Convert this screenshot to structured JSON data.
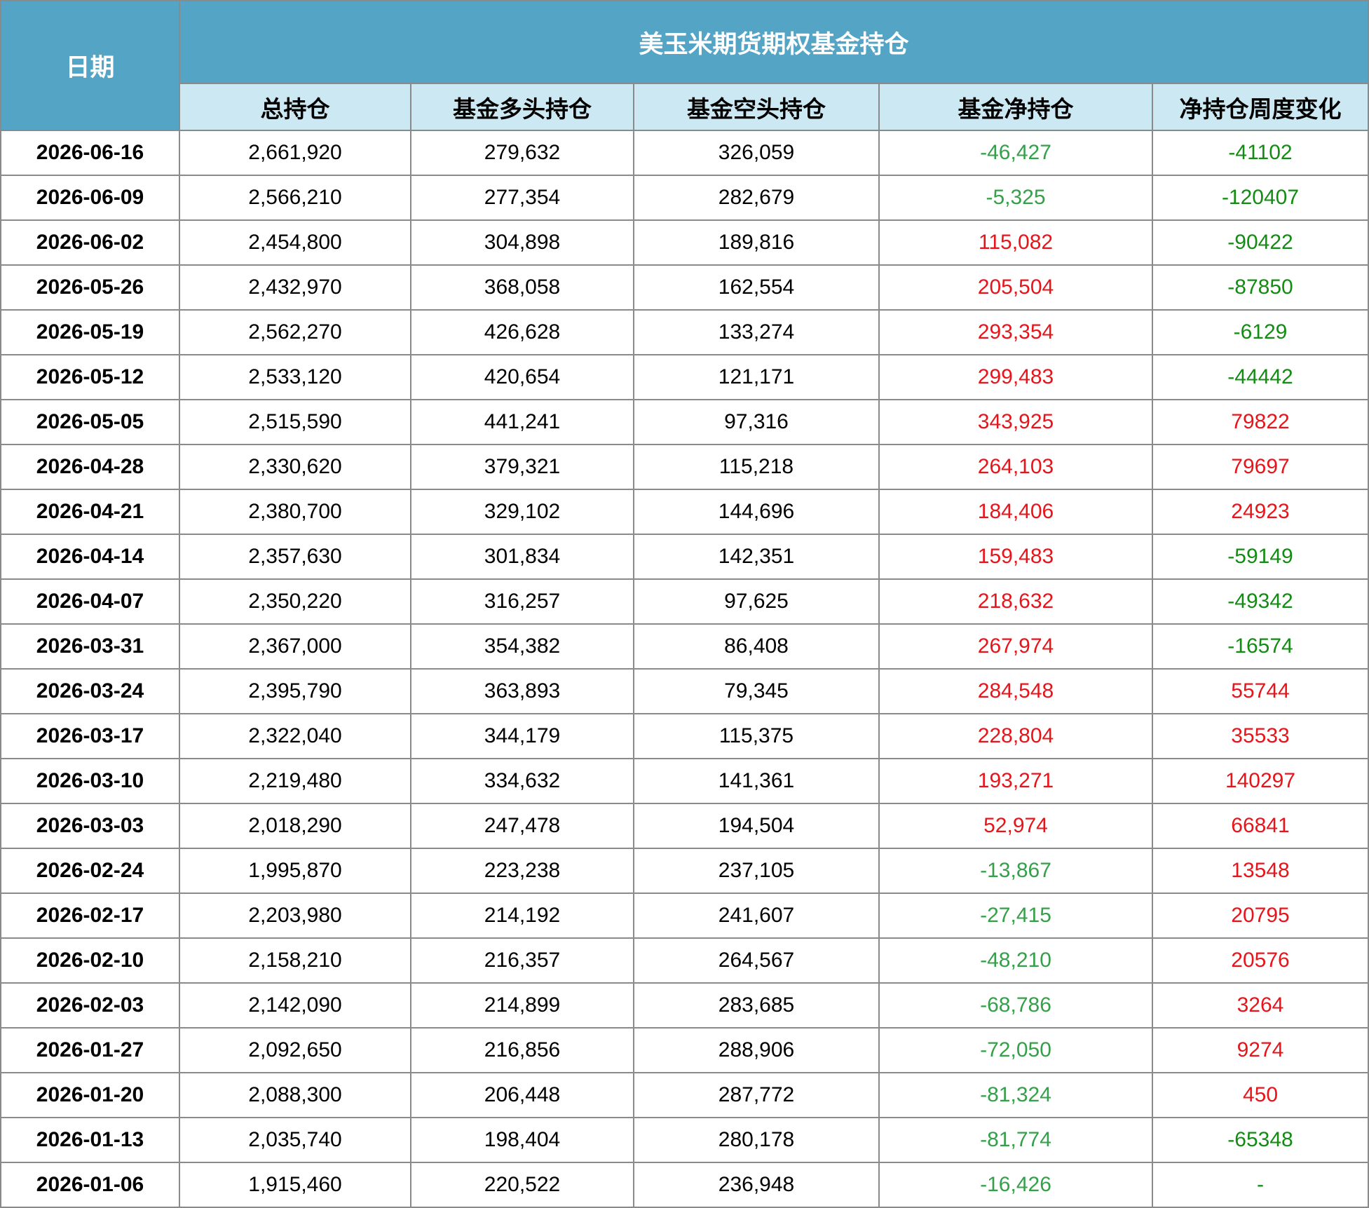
{
  "colors": {
    "header_dark": "#54a4c6",
    "header_light": "#cce8f2",
    "grid": "#8a8a8a",
    "positive": "#e8141a",
    "net_negative": "#35a04a",
    "change_negative": "#128c12"
  },
  "chart_data": {
    "type": "table",
    "title": "美玉米期货期权基金持仓",
    "row_header": "日期",
    "columns": [
      "总持仓",
      "基金多头持仓",
      "基金空头持仓",
      "基金净持仓",
      "净持仓周度变化"
    ],
    "rows": [
      [
        "2026-06-16",
        "2,661,920",
        "279,632",
        "326,059",
        "-46,427",
        "-41102"
      ],
      [
        "2026-06-09",
        "2,566,210",
        "277,354",
        "282,679",
        "-5,325",
        "-120407"
      ],
      [
        "2026-06-02",
        "2,454,800",
        "304,898",
        "189,816",
        "115,082",
        "-90422"
      ],
      [
        "2026-05-26",
        "2,432,970",
        "368,058",
        "162,554",
        "205,504",
        "-87850"
      ],
      [
        "2026-05-19",
        "2,562,270",
        "426,628",
        "133,274",
        "293,354",
        "-6129"
      ],
      [
        "2026-05-12",
        "2,533,120",
        "420,654",
        "121,171",
        "299,483",
        "-44442"
      ],
      [
        "2026-05-05",
        "2,515,590",
        "441,241",
        "97,316",
        "343,925",
        "79822"
      ],
      [
        "2026-04-28",
        "2,330,620",
        "379,321",
        "115,218",
        "264,103",
        "79697"
      ],
      [
        "2026-04-21",
        "2,380,700",
        "329,102",
        "144,696",
        "184,406",
        "24923"
      ],
      [
        "2026-04-14",
        "2,357,630",
        "301,834",
        "142,351",
        "159,483",
        "-59149"
      ],
      [
        "2026-04-07",
        "2,350,220",
        "316,257",
        "97,625",
        "218,632",
        "-49342"
      ],
      [
        "2026-03-31",
        "2,367,000",
        "354,382",
        "86,408",
        "267,974",
        "-16574"
      ],
      [
        "2026-03-24",
        "2,395,790",
        "363,893",
        "79,345",
        "284,548",
        "55744"
      ],
      [
        "2026-03-17",
        "2,322,040",
        "344,179",
        "115,375",
        "228,804",
        "35533"
      ],
      [
        "2026-03-10",
        "2,219,480",
        "334,632",
        "141,361",
        "193,271",
        "140297"
      ],
      [
        "2026-03-03",
        "2,018,290",
        "247,478",
        "194,504",
        "52,974",
        "66841"
      ],
      [
        "2026-02-24",
        "1,995,870",
        "223,238",
        "237,105",
        "-13,867",
        "13548"
      ],
      [
        "2026-02-17",
        "2,203,980",
        "214,192",
        "241,607",
        "-27,415",
        "20795"
      ],
      [
        "2026-02-10",
        "2,158,210",
        "216,357",
        "264,567",
        "-48,210",
        "20576"
      ],
      [
        "2026-02-03",
        "2,142,090",
        "214,899",
        "283,685",
        "-68,786",
        "3264"
      ],
      [
        "2026-01-27",
        "2,092,650",
        "216,856",
        "288,906",
        "-72,050",
        "9274"
      ],
      [
        "2026-01-20",
        "2,088,300",
        "206,448",
        "287,772",
        "-81,324",
        "450"
      ],
      [
        "2026-01-13",
        "2,035,740",
        "198,404",
        "280,178",
        "-81,774",
        "-65348"
      ],
      [
        "2026-01-06",
        "1,915,460",
        "220,522",
        "236,948",
        "-16,426",
        "-"
      ]
    ]
  }
}
